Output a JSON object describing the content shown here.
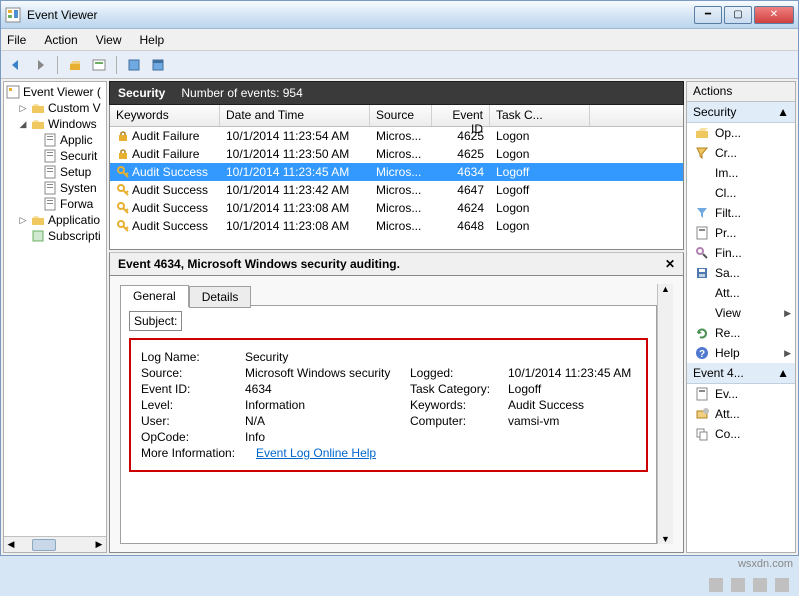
{
  "title": "Event Viewer",
  "menu": {
    "file": "File",
    "action": "Action",
    "view": "View",
    "help": "Help"
  },
  "tree": {
    "root": "Event Viewer (",
    "items": [
      {
        "twist": "▷",
        "label": "Custom V",
        "indent": 1,
        "icon": "folder"
      },
      {
        "twist": "◢",
        "label": "Windows",
        "indent": 1,
        "icon": "folder"
      },
      {
        "twist": "",
        "label": "Applic",
        "indent": 2,
        "icon": "log"
      },
      {
        "twist": "",
        "label": "Securit",
        "indent": 2,
        "icon": "log"
      },
      {
        "twist": "",
        "label": "Setup",
        "indent": 2,
        "icon": "log"
      },
      {
        "twist": "",
        "label": "Systen",
        "indent": 2,
        "icon": "log"
      },
      {
        "twist": "",
        "label": "Forwa",
        "indent": 2,
        "icon": "log"
      },
      {
        "twist": "▷",
        "label": "Applicatio",
        "indent": 1,
        "icon": "folder"
      },
      {
        "twist": "",
        "label": "Subscripti",
        "indent": 1,
        "icon": "sub"
      }
    ]
  },
  "section": {
    "title": "Security",
    "count": "Number of events: 954"
  },
  "columns": {
    "kw": "Keywords",
    "dt": "Date and Time",
    "src": "Source",
    "id": "Event ID",
    "tc": "Task C..."
  },
  "rows": [
    {
      "kw": "Audit Failure",
      "icon": "lock",
      "dt": "10/1/2014 11:23:54 AM",
      "src": "Micros...",
      "id": "4625",
      "tc": "Logon",
      "sel": false
    },
    {
      "kw": "Audit Failure",
      "icon": "lock",
      "dt": "10/1/2014 11:23:50 AM",
      "src": "Micros...",
      "id": "4625",
      "tc": "Logon",
      "sel": false
    },
    {
      "kw": "Audit Success",
      "icon": "key",
      "dt": "10/1/2014 11:23:45 AM",
      "src": "Micros...",
      "id": "4634",
      "tc": "Logoff",
      "sel": true
    },
    {
      "kw": "Audit Success",
      "icon": "key",
      "dt": "10/1/2014 11:23:42 AM",
      "src": "Micros...",
      "id": "4647",
      "tc": "Logoff",
      "sel": false
    },
    {
      "kw": "Audit Success",
      "icon": "key",
      "dt": "10/1/2014 11:23:08 AM",
      "src": "Micros...",
      "id": "4624",
      "tc": "Logon",
      "sel": false
    },
    {
      "kw": "Audit Success",
      "icon": "key",
      "dt": "10/1/2014 11:23:08 AM",
      "src": "Micros...",
      "id": "4648",
      "tc": "Logon",
      "sel": false
    }
  ],
  "detail": {
    "header": "Event 4634, Microsoft Windows security auditing.",
    "tabs": {
      "general": "General",
      "details": "Details"
    },
    "subject": "Subject:",
    "fields": {
      "logname_l": "Log Name:",
      "logname_v": "Security",
      "source_l": "Source:",
      "source_v": "Microsoft Windows security",
      "logged_l": "Logged:",
      "logged_v": "10/1/2014 11:23:45 AM",
      "eventid_l": "Event ID:",
      "eventid_v": "4634",
      "taskcat_l": "Task Category:",
      "taskcat_v": "Logoff",
      "level_l": "Level:",
      "level_v": "Information",
      "keywords_l": "Keywords:",
      "keywords_v": "Audit Success",
      "user_l": "User:",
      "user_v": "N/A",
      "computer_l": "Computer:",
      "computer_v": "vamsi-vm",
      "opcode_l": "OpCode:",
      "opcode_v": "Info",
      "moreinfo_l": "More Information:",
      "moreinfo_v": "Event Log Online Help"
    }
  },
  "actions": {
    "header": "Actions",
    "sec1": "Security",
    "items1": [
      {
        "label": "Op...",
        "icon": "open"
      },
      {
        "label": "Cr...",
        "icon": "create"
      },
      {
        "label": "Im...",
        "icon": "none"
      },
      {
        "label": "Cl...",
        "icon": "none"
      },
      {
        "label": "Filt...",
        "icon": "filter"
      },
      {
        "label": "Pr...",
        "icon": "props"
      },
      {
        "label": "Fin...",
        "icon": "find"
      },
      {
        "label": "Sa...",
        "icon": "save"
      },
      {
        "label": "Att...",
        "icon": "none"
      },
      {
        "label": "View",
        "icon": "none",
        "sub": true
      },
      {
        "label": "Re...",
        "icon": "refresh"
      },
      {
        "label": "Help",
        "icon": "help",
        "sub": true
      }
    ],
    "sec2": "Event 4...",
    "items2": [
      {
        "label": "Ev...",
        "icon": "props"
      },
      {
        "label": "Att...",
        "icon": "attach"
      },
      {
        "label": "Co...",
        "icon": "copy"
      }
    ]
  },
  "watermark": "wsxdn.com"
}
